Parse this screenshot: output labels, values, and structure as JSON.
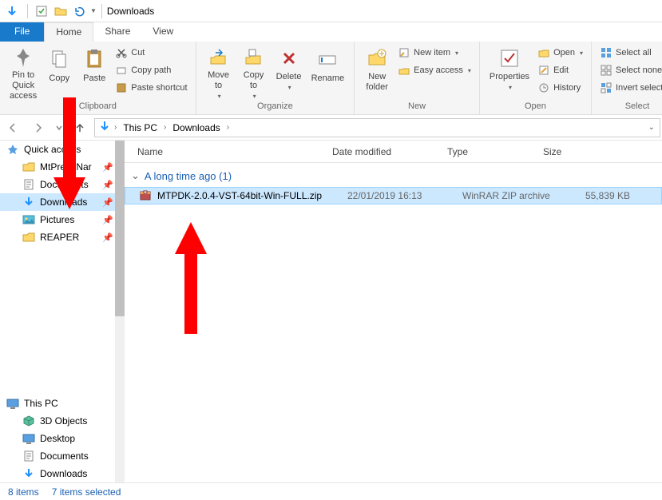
{
  "title": "Downloads",
  "tabs": {
    "file": "File",
    "home": "Home",
    "share": "Share",
    "view": "View"
  },
  "ribbon": {
    "clipboard": {
      "label": "Clipboard",
      "pin": "Pin to Quick\naccess",
      "copy": "Copy",
      "paste": "Paste",
      "cut": "Cut",
      "copypath": "Copy path",
      "pasteshortcut": "Paste shortcut"
    },
    "organize": {
      "label": "Organize",
      "moveto": "Move\nto",
      "copyto": "Copy\nto",
      "delete": "Delete",
      "rename": "Rename"
    },
    "new": {
      "label": "New",
      "newfolder": "New\nfolder",
      "newitem": "New item",
      "easyaccess": "Easy access"
    },
    "open": {
      "label": "Open",
      "properties": "Properties",
      "open": "Open",
      "edit": "Edit",
      "history": "History"
    },
    "select": {
      "label": "Select",
      "selectall": "Select all",
      "selectnone": "Select none",
      "invert": "Invert selection"
    }
  },
  "breadcrumb": {
    "pc": "This PC",
    "downloads": "Downloads"
  },
  "sidebar": {
    "quickaccess": "Quick access",
    "items": [
      {
        "label": "MtPreIteNar",
        "pinned": true
      },
      {
        "label": "Documents",
        "pinned": true
      },
      {
        "label": "Downloads",
        "pinned": true,
        "selected": true
      },
      {
        "label": "Pictures",
        "pinned": true
      },
      {
        "label": "REAPER",
        "pinned": true
      }
    ],
    "thispc": "This PC",
    "pcitems": [
      {
        "label": "3D Objects"
      },
      {
        "label": "Desktop"
      },
      {
        "label": "Documents"
      },
      {
        "label": "Downloads"
      }
    ]
  },
  "columns": {
    "name": "Name",
    "date": "Date modified",
    "type": "Type",
    "size": "Size"
  },
  "group": "A long time ago (1)",
  "file": {
    "name": "MTPDK-2.0.4-VST-64bit-Win-FULL.zip",
    "date": "22/01/2019 16:13",
    "type": "WinRAR ZIP archive",
    "size": "55,839 KB"
  },
  "status": {
    "items": "8 items",
    "selected": "7 items selected"
  }
}
